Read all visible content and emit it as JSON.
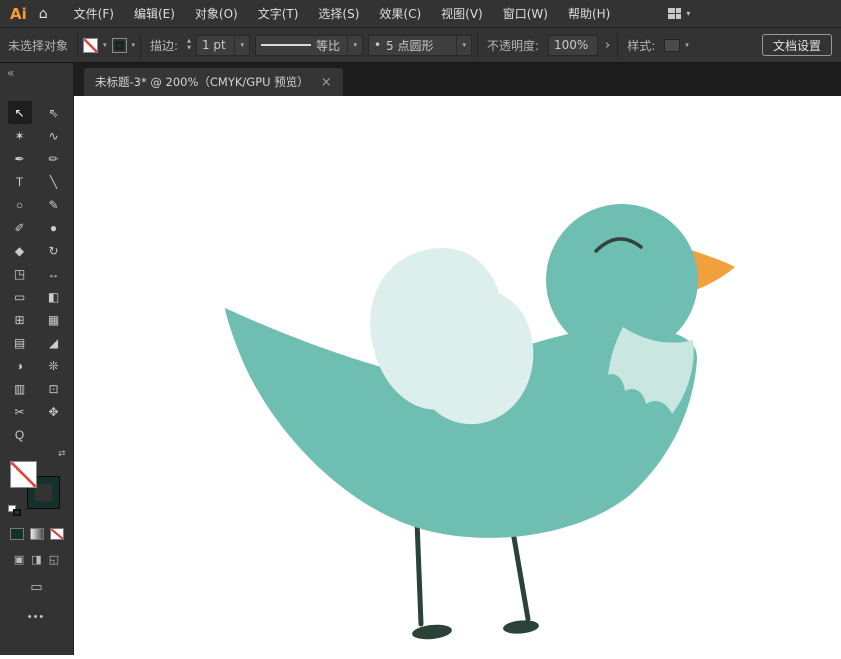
{
  "menu_bar": {
    "logo": "Ai",
    "home_glyph": "⌂",
    "items": [
      "文件(F)",
      "编辑(E)",
      "对象(O)",
      "文字(T)",
      "选择(S)",
      "效果(C)",
      "视图(V)",
      "窗口(W)",
      "帮助(H)"
    ],
    "workspace_chevron": "▾"
  },
  "control_bar": {
    "selection_status": "未选择对象",
    "fill_chevron": "▾",
    "stroke_swatch_chevron": "▾",
    "stroke_label": "描边:",
    "stepper_up": "▲",
    "stepper_down": "▼",
    "stroke_weight": "1 pt",
    "weight_chevron": "▾",
    "profile_label": "等比",
    "profile_chevron": "▾",
    "brush_bullet": "•",
    "brush_name": "5 点圆形",
    "brush_chevron": "▾",
    "opacity_label": "不透明度:",
    "opacity_value": "100%",
    "opacity_arrow": "›",
    "style_label": "样式:",
    "style_chevron": "▾",
    "document_setup": "文档设置"
  },
  "tab_bar": {
    "collapse_glyph": "«",
    "tab_title": "未标题-3* @ 200%（CMYK/GPU 预览）",
    "close_glyph": "×"
  },
  "toolbar": {
    "tools": [
      {
        "name": "selection-tool",
        "glyph": "↖",
        "active": true
      },
      {
        "name": "direct-selection-tool",
        "glyph": "⇖"
      },
      {
        "name": "magic-wand-tool",
        "glyph": "✶"
      },
      {
        "name": "lasso-tool",
        "glyph": "∿"
      },
      {
        "name": "pen-tool",
        "glyph": "✒"
      },
      {
        "name": "curvature-tool",
        "glyph": "✏"
      },
      {
        "name": "type-tool",
        "glyph": "T"
      },
      {
        "name": "line-segment-tool",
        "glyph": "╲"
      },
      {
        "name": "ellipse-tool",
        "glyph": "○"
      },
      {
        "name": "paintbrush-tool",
        "glyph": "✎"
      },
      {
        "name": "shaper-tool",
        "glyph": "✐"
      },
      {
        "name": "blob-brush-tool",
        "glyph": "●"
      },
      {
        "name": "eraser-tool",
        "glyph": "◆"
      },
      {
        "name": "rotate-tool",
        "glyph": "↻"
      },
      {
        "name": "scale-tool",
        "glyph": "◳"
      },
      {
        "name": "width-tool",
        "glyph": "↔"
      },
      {
        "name": "free-transform-tool",
        "glyph": "▭"
      },
      {
        "name": "shape-builder-tool",
        "glyph": "◧"
      },
      {
        "name": "perspective-grid-tool",
        "glyph": "⊞"
      },
      {
        "name": "mesh-tool",
        "glyph": "▦"
      },
      {
        "name": "gradient-tool",
        "glyph": "▤"
      },
      {
        "name": "eyedropper-tool",
        "glyph": "◢"
      },
      {
        "name": "blend-tool",
        "glyph": "◑"
      },
      {
        "name": "symbol-sprayer-tool",
        "glyph": "❊"
      },
      {
        "name": "column-graph-tool",
        "glyph": "▥"
      },
      {
        "name": "artboard-tool",
        "glyph": "⊡"
      },
      {
        "name": "slice-tool",
        "glyph": "✂"
      },
      {
        "name": "hand-tool",
        "glyph": "✥"
      },
      {
        "name": "zoom-tool",
        "glyph": "Q"
      }
    ],
    "swap_glyph": "⇄",
    "drawing_modes": [
      {
        "name": "draw-normal-mode",
        "glyph": "▣"
      },
      {
        "name": "draw-behind-mode",
        "glyph": "◨"
      },
      {
        "name": "draw-inside-mode",
        "glyph": "◱"
      }
    ],
    "screen_mode_glyph": "▭",
    "more_glyph": "•••"
  },
  "colors": {
    "logo_orange": "#ff9a33",
    "none_red": "#e0443e",
    "bird_body": "#6fbeb2",
    "bird_wing": "#ddefec",
    "bird_neck_feathers": "#c9e6e1",
    "bird_beak": "#f0a03c",
    "bird_legs": "#2a4237",
    "bird_eye": "#32423c"
  }
}
